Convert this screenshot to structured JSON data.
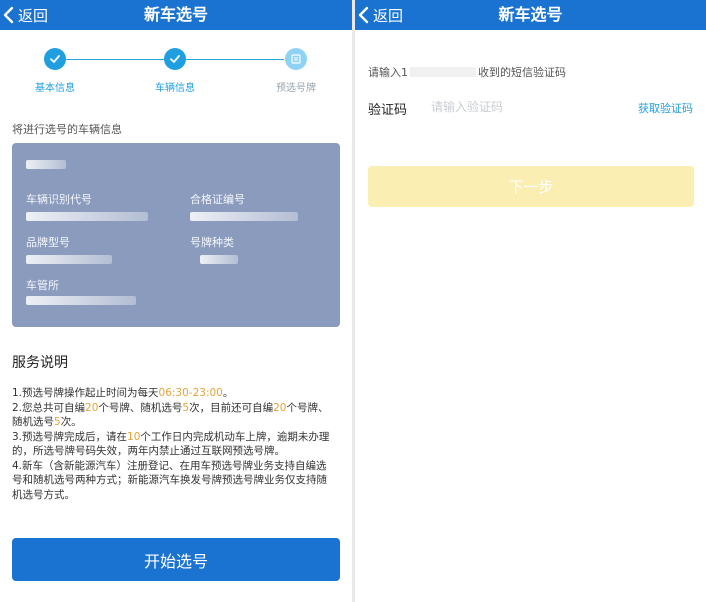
{
  "left": {
    "back_label": "返回",
    "title": "新车选号",
    "steps": [
      {
        "label": "基本信息",
        "state": "done"
      },
      {
        "label": "车辆信息",
        "state": "done"
      },
      {
        "label": "预选号牌",
        "state": "pending"
      }
    ],
    "section_label": "将进行选号的车辆信息",
    "card": {
      "vin_label": "车辆识别代号",
      "cert_label": "合格证编号",
      "model_label": "品牌型号",
      "plate_type_label": "号牌种类",
      "office_label": "车管所"
    },
    "service": {
      "title": "服务说明",
      "l1a": "1.预选号牌操作起止时间为每天",
      "l1b": "06:30-23:00",
      "l1c": "。",
      "l2a": "2.您总共可自编",
      "l2b": "20",
      "l2c": "个号牌、随机选号",
      "l2d": "5",
      "l2e": "次，目前还可自编",
      "l2f": "20",
      "l2g": "个号牌、随机选号",
      "l2h": "5",
      "l2i": "次。",
      "l3a": "3.预选号牌完成后，请在",
      "l3b": "10",
      "l3c": "个工作日内完成机动车上牌，逾期未办理的，所选号牌号码失效，两年内禁止通过互联网预选号牌。",
      "l4": "4.新车（含新能源汽车）注册登记、在用车预选号牌业务支持自编选号和随机选号两种方式；新能源汽车换发号牌预选号牌业务仅支持随机选号方式。"
    },
    "start_button": "开始选号"
  },
  "right": {
    "back_label": "返回",
    "title": "新车选号",
    "hint_prefix": "请输入1",
    "hint_suffix": "收到的短信验证码",
    "code_label": "验证码",
    "code_placeholder": "请输入验证码",
    "code_value": "",
    "get_code": "获取验证码",
    "next_button": "下一步"
  },
  "colors": {
    "header": "#1a73d0",
    "accent": "#1f9ee0",
    "highlight": "#e6a33a",
    "disabled_button": "#fbeeb2",
    "card": "#8a9bbd"
  }
}
